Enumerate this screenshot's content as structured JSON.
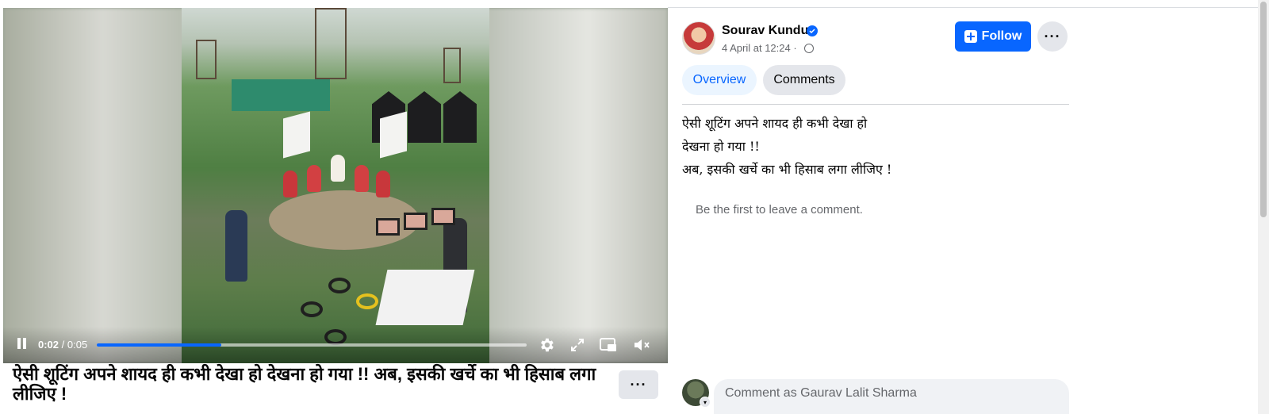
{
  "video": {
    "current_time": "0:02",
    "separator": " / ",
    "total_time": "0:05",
    "progress_percent": 29
  },
  "caption": {
    "text": "ऐसी शूटिंग अपने शायद ही कभी देखा हो देखना हो गया !! अब, इसकी खर्चे का भी हिसाब लगा लीजिए !"
  },
  "author": {
    "name": "Sourav Kundu",
    "timestamp": "4 April at 12:24 ·",
    "verified": true
  },
  "actions": {
    "follow_label": "Follow"
  },
  "tabs": [
    {
      "label": "Overview",
      "active": true
    },
    {
      "label": "Comments",
      "active": false
    }
  ],
  "post": {
    "lines": [
      "ऐसी शूटिंग अपने शायद ही कभी देखा हो",
      "देखना हो गया !!",
      "अब, इसकी खर्चे का भी हिसाब लगा लीजिए !"
    ]
  },
  "comments": {
    "empty_message": "Be the first to leave a comment.",
    "input_placeholder": "Comment as Gaurav Lalit Sharma"
  },
  "colors": {
    "accent": "#0866ff",
    "secondary_bg": "#e4e6eb",
    "muted_text": "#65676b"
  },
  "icons": [
    "pause-icon",
    "settings-icon",
    "fullscreen-icon",
    "miniplayer-icon",
    "mute-icon",
    "more-icon",
    "verified-icon",
    "globe-icon",
    "follow-icon",
    "chevron-down-icon"
  ]
}
